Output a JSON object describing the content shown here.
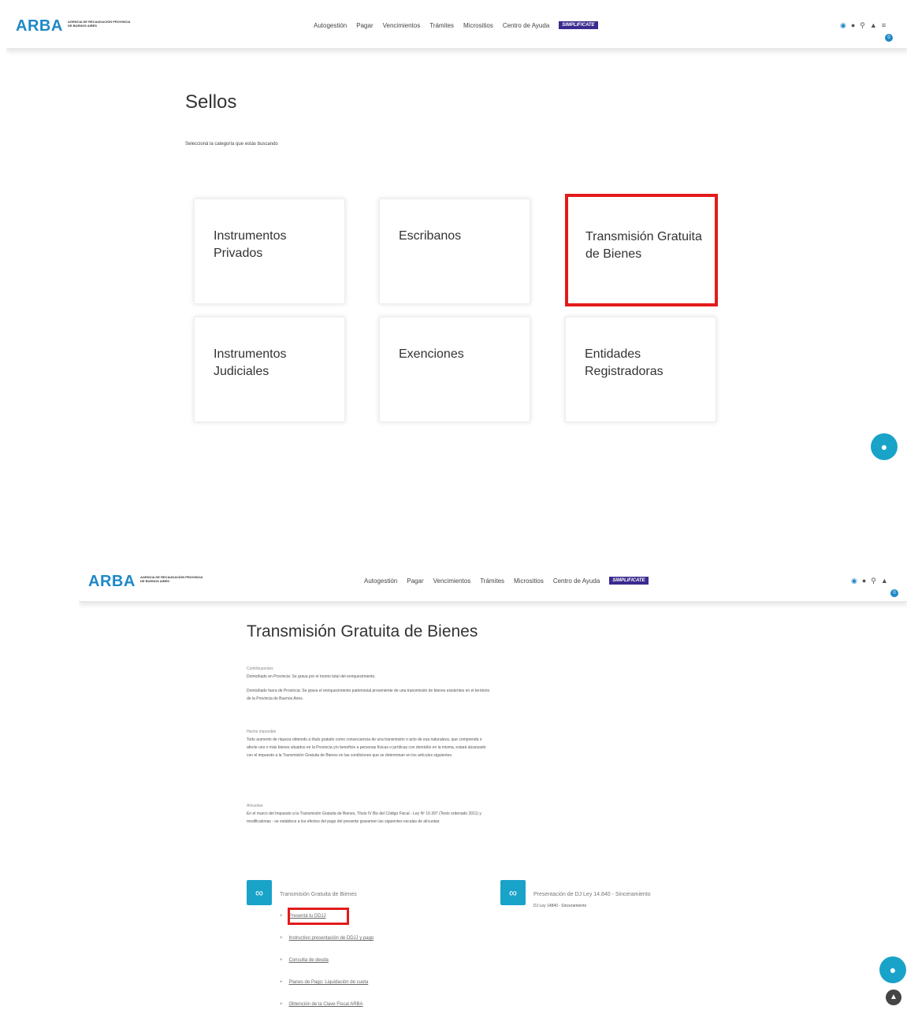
{
  "header": {
    "logo": "ARBA",
    "logo_sub": "AGENCIA DE RECAUDACIÓN PROVINCIA DE BUENOS AIRES",
    "nav": [
      "Autogestión",
      "Pagar",
      "Vencimientos",
      "Trámites",
      "Micrositios",
      "Centro de Ayuda"
    ],
    "simplificate": "SIMPLIFICATE",
    "notification_count": "0"
  },
  "page1": {
    "title": "Sellos",
    "subtitle": "Seleccioná la categoría que estás buscando",
    "cards": [
      {
        "label": "Instrumentos Privados"
      },
      {
        "label": "Escribanos"
      },
      {
        "label": "Transmisión Gratuita de Bienes"
      },
      {
        "label": "Instrumentos Judiciales"
      },
      {
        "label": "Exenciones"
      },
      {
        "label": "Entidades Registradoras"
      }
    ]
  },
  "page2": {
    "title": "Transmisión Gratuita de Bienes",
    "contribuyentes_heading": "Contribuyentes",
    "contribuyentes_p1": "Domiciliado en Provincia: Se grava por el monto total del enriquecimiento.",
    "contribuyentes_p2": "Domiciliado fuera de Provincia: Se grava el enriquecimiento patrimonial proveniente de una transmisión de bienes existentes en el territorio de la Provincia de Buenos Aires.",
    "hecho_heading": "Hecho imponible",
    "hecho_p": "Todo aumento de riqueza obtenido a título gratuito como consecuencia de una transmisión o acto de esa naturaleza, que comprenda o afecte uno o más bienes situados en la Provincia y/o beneficie a personas físicas o jurídicas con domicilio en la misma, estará alcanzado con el impuesto a la Transmisión Gratuita de Bienes en las condiciones que se determinan en los artículos siguientes.",
    "alicuotas_heading": "Alícuotas",
    "alicuotas_p": "En el marco del Impuesto a la Transmisión Gratuita de Bienes, Título IV Bis del Código Fiscal - Ley Nº 10.397 (Texto ordenado 2011) y modificatorias - se establece a los efectos del pago del presente gravamen las siguientes escalas de alícuotas:",
    "block1_title": "Transmisión Gratuita de Bienes",
    "block2_title": "Presentación de DJ Ley 14.840 - Sinceramiento",
    "block2_sub": "DJ Ley 14840 - Sinceramiento",
    "links": [
      "Presentá tu DDJJ",
      "Instructivo presentación de DDJJ y pago",
      "Consulta de deuda",
      "Planes de Pago: Liquidación de cuota",
      "Obtención de la Clave Fiscal ARBA"
    ]
  }
}
